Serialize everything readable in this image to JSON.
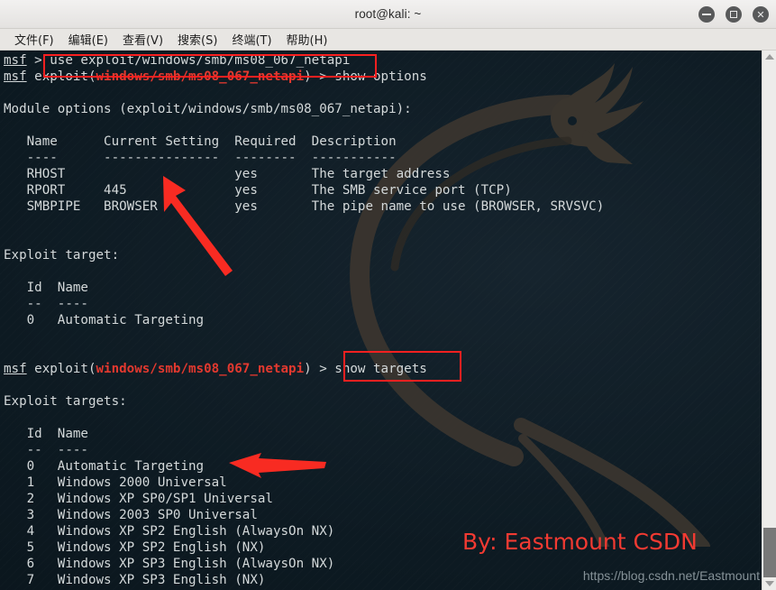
{
  "window": {
    "title": "root@kali: ~",
    "buttons": {
      "minimize": "minimize",
      "maximize": "maximize",
      "close": "close"
    }
  },
  "menubar": {
    "items": [
      {
        "label": "文件(F)",
        "name": "menu-file"
      },
      {
        "label": "编辑(E)",
        "name": "menu-edit"
      },
      {
        "label": "查看(V)",
        "name": "menu-view"
      },
      {
        "label": "搜索(S)",
        "name": "menu-search"
      },
      {
        "label": "终端(T)",
        "name": "menu-terminal"
      },
      {
        "label": "帮助(H)",
        "name": "menu-help"
      }
    ]
  },
  "terminal": {
    "prompt_name": "msf",
    "module_path": "windows/smb/ms08_067_netapi",
    "lines": [
      {
        "t": "prompt1"
      },
      {
        "t": "prompt2"
      },
      {
        "t": "blank"
      },
      {
        "t": "plain",
        "s": "Module options (exploit/windows/smb/ms08_067_netapi):"
      },
      {
        "t": "blank"
      },
      {
        "t": "plain",
        "s": "   Name      Current Setting  Required  Description"
      },
      {
        "t": "plain",
        "s": "   ----      ---------------  --------  -----------"
      },
      {
        "t": "plain",
        "s": "   RHOST                      yes       The target address"
      },
      {
        "t": "plain",
        "s": "   RPORT     445              yes       The SMB service port (TCP)"
      },
      {
        "t": "plain",
        "s": "   SMBPIPE   BROWSER          yes       The pipe name to use (BROWSER, SRVSVC)"
      },
      {
        "t": "blank"
      },
      {
        "t": "blank"
      },
      {
        "t": "plain",
        "s": "Exploit target:"
      },
      {
        "t": "blank"
      },
      {
        "t": "plain",
        "s": "   Id  Name"
      },
      {
        "t": "plain",
        "s": "   --  ----"
      },
      {
        "t": "plain",
        "s": "   0   Automatic Targeting"
      },
      {
        "t": "blank"
      },
      {
        "t": "blank"
      },
      {
        "t": "prompt3"
      },
      {
        "t": "blank"
      },
      {
        "t": "plain",
        "s": "Exploit targets:"
      },
      {
        "t": "blank"
      },
      {
        "t": "plain",
        "s": "   Id  Name"
      },
      {
        "t": "plain",
        "s": "   --  ----"
      },
      {
        "t": "plain",
        "s": "   0   Automatic Targeting"
      },
      {
        "t": "plain",
        "s": "   1   Windows 2000 Universal"
      },
      {
        "t": "plain",
        "s": "   2   Windows XP SP0/SP1 Universal"
      },
      {
        "t": "plain",
        "s": "   3   Windows 2003 SP0 Universal"
      },
      {
        "t": "plain",
        "s": "   4   Windows XP SP2 English (AlwaysOn NX)"
      },
      {
        "t": "plain",
        "s": "   5   Windows XP SP2 English (NX)"
      },
      {
        "t": "plain",
        "s": "   6   Windows XP SP3 English (AlwaysOn NX)"
      },
      {
        "t": "plain",
        "s": "   7   Windows XP SP3 English (NX)"
      }
    ],
    "command_1": "use exploit/windows/smb/ms08_067_netapi",
    "command_2": "show options",
    "command_3": "show targets",
    "prompt_arrow": " > ",
    "exploit_word": "exploit("
  },
  "module_options_table": {
    "headers": [
      "Name",
      "Current Setting",
      "Required",
      "Description"
    ],
    "rows": [
      [
        "RHOST",
        "",
        "yes",
        "The target address"
      ],
      [
        "RPORT",
        "445",
        "yes",
        "The SMB service port (TCP)"
      ],
      [
        "SMBPIPE",
        "BROWSER",
        "yes",
        "The pipe name to use (BROWSER, SRVSVC)"
      ]
    ]
  },
  "exploit_targets_table": {
    "headers": [
      "Id",
      "Name"
    ],
    "rows": [
      [
        "0",
        "Automatic Targeting"
      ],
      [
        "1",
        "Windows 2000 Universal"
      ],
      [
        "2",
        "Windows XP SP0/SP1 Universal"
      ],
      [
        "3",
        "Windows 2003 SP0 Universal"
      ],
      [
        "4",
        "Windows XP SP2 English (AlwaysOn NX)"
      ],
      [
        "5",
        "Windows XP SP2 English (NX)"
      ],
      [
        "6",
        "Windows XP SP3 English (AlwaysOn NX)"
      ],
      [
        "7",
        "Windows XP SP3 English (NX)"
      ]
    ]
  },
  "annotations": {
    "byline": "By: Eastmount CSDN",
    "watermark": "https://blog.csdn.net/Eastmount",
    "highlight_color": "#fb2020",
    "byline_color": "#f23a32"
  },
  "scrollbar": {
    "up_arrow": "scroll-up",
    "down_arrow": "scroll-down",
    "thumb": "scroll-thumb"
  }
}
